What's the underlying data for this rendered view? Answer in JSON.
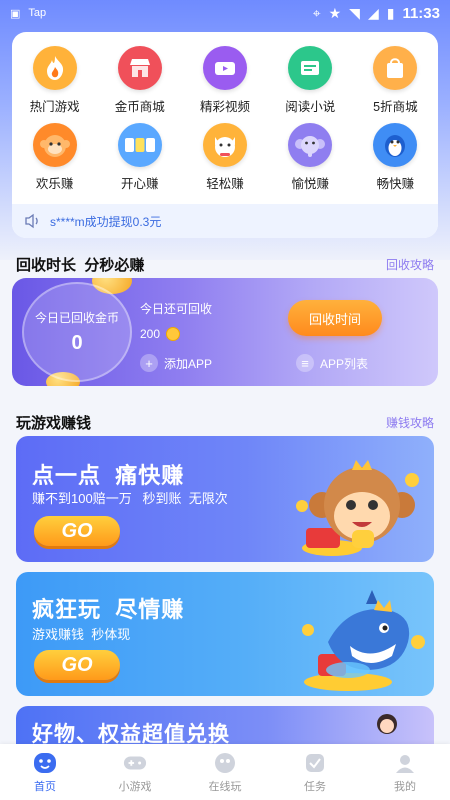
{
  "status_bar": {
    "app": "Tap",
    "time": "11:33"
  },
  "menu": {
    "items": [
      {
        "label": "热门游戏",
        "icon": "flame-icon",
        "color": "#ffb23a"
      },
      {
        "label": "金币商城",
        "icon": "store-icon",
        "color": "#f0505a"
      },
      {
        "label": "精彩视频",
        "icon": "video-icon",
        "color": "#9a5cf0"
      },
      {
        "label": "阅读小说",
        "icon": "book-icon",
        "color": "#2cc78b"
      },
      {
        "label": "5折商城",
        "icon": "shopping-bag-icon",
        "color": "#ffb04a"
      },
      {
        "label": "欢乐赚",
        "icon": "monkey-icon",
        "color": "#ff8a2a"
      },
      {
        "label": "开心赚",
        "icon": "number-game-icon",
        "color": "#5aa8ff"
      },
      {
        "label": "轻松赚",
        "icon": "lucky-cat-icon",
        "color": "#ffb33a"
      },
      {
        "label": "愉悦赚",
        "icon": "elephant-icon",
        "color": "#8f7ef0"
      },
      {
        "label": "畅快赚",
        "icon": "penguin-icon",
        "color": "#3f8df5"
      }
    ]
  },
  "notice": {
    "text": "s****m成功提现0.3元"
  },
  "recycle_section": {
    "title": "回收时长  分秒必赚",
    "link": "回收攻略",
    "coin_label": "今日已回收金币",
    "coin_value": "0",
    "remaining_label": "今日还可回收",
    "remaining_value": "200",
    "button_label": "回收时间",
    "add_app_label": "添加APP",
    "app_list_label": "APP列表"
  },
  "game_section": {
    "title": "玩游戏赚钱",
    "link": "赚钱攻略"
  },
  "banners": [
    {
      "title": "点一点  痛快赚",
      "subtitle": "赚不到100赔一万   秒到账  无限次",
      "button": "GO"
    },
    {
      "title": "疯狂玩  尽情赚",
      "subtitle": "游戏赚钱  秒体现",
      "button": "GO"
    },
    {
      "title": "好物、权益超值兑换"
    }
  ],
  "tabs": [
    {
      "label": "首页",
      "icon": "home-face-icon",
      "active": true
    },
    {
      "label": "小游戏",
      "icon": "gamepad-icon",
      "active": false
    },
    {
      "label": "在线玩",
      "icon": "controller-icon",
      "active": false
    },
    {
      "label": "任务",
      "icon": "task-icon",
      "active": false
    },
    {
      "label": "我的",
      "icon": "profile-icon",
      "active": false
    }
  ],
  "colors": {
    "accent": "#3b6cf0",
    "link": "#8d7bf0",
    "go_button": "#ff9a1a"
  }
}
